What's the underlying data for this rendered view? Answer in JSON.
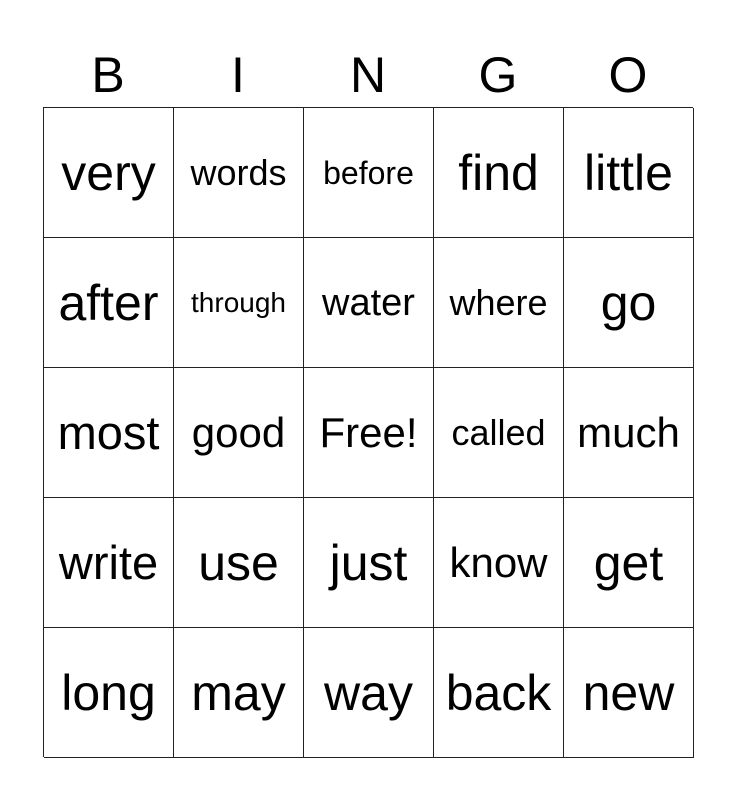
{
  "header": {
    "letters": [
      "B",
      "I",
      "N",
      "G",
      "O"
    ]
  },
  "grid": {
    "rows": [
      [
        "very",
        "words",
        "before",
        "find",
        "little"
      ],
      [
        "after",
        "through",
        "water",
        "where",
        "go"
      ],
      [
        "most",
        "good",
        "Free!",
        "called",
        "much"
      ],
      [
        "write",
        "use",
        "just",
        "know",
        "get"
      ],
      [
        "long",
        "may",
        "way",
        "back",
        "new"
      ]
    ],
    "free_space": "Free!"
  }
}
